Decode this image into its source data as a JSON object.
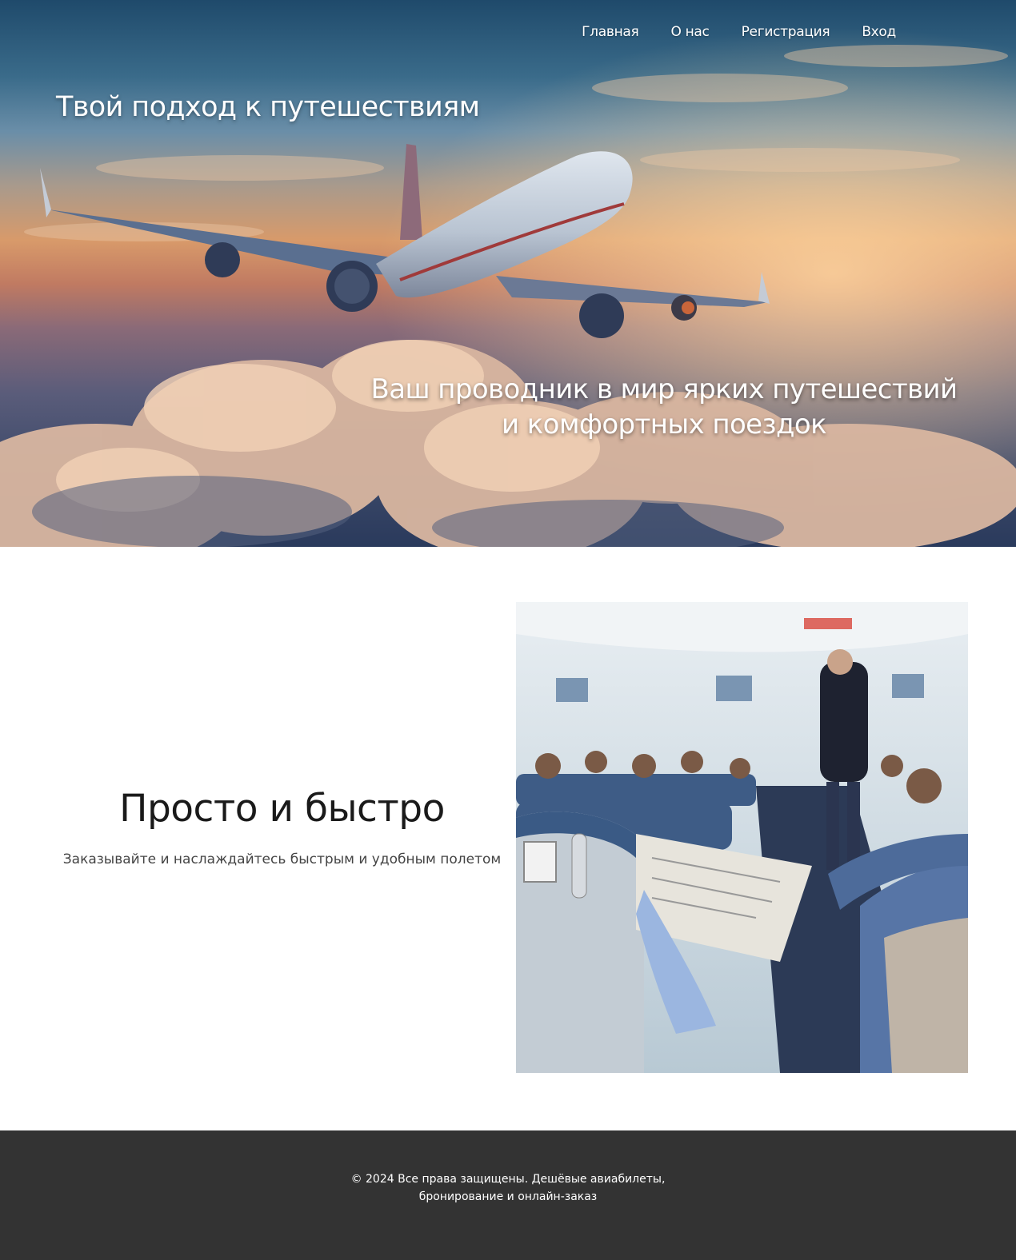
{
  "nav": {
    "items": [
      {
        "label": "Главная"
      },
      {
        "label": "О нас"
      },
      {
        "label": "Регистрация"
      },
      {
        "label": "Вход"
      }
    ]
  },
  "hero": {
    "title": "Твой подход к путешествиям",
    "subtitle": "Ваш проводник в мир ярких путешествий и комфортных поездок",
    "image": "airplane-above-clouds-at-sunset"
  },
  "feature": {
    "heading": "Просто и быстро",
    "description": "Заказывайте и наслаждайтесь быстрым и удобным полетом",
    "image": "airplane-cabin-with-passengers"
  },
  "footer": {
    "text": "© 2024 Все права защищены. Дешёвые авиабилеты, бронирование и онлайн-заказ"
  },
  "colors": {
    "footer_bg": "#333333",
    "text_light": "#ffffff",
    "heading_dark": "#1a1a1a"
  }
}
